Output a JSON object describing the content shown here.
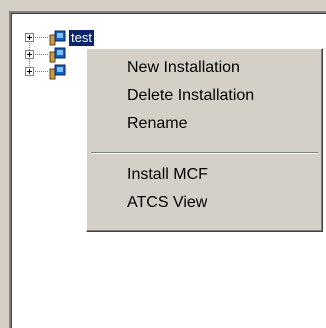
{
  "tree": {
    "items": [
      {
        "label": "test",
        "selected": true
      },
      {
        "label": ""
      },
      {
        "label": ""
      }
    ]
  },
  "context_menu": {
    "items": [
      {
        "label": "New Installation"
      },
      {
        "label": "Delete Installation"
      },
      {
        "label": "Rename"
      },
      {
        "label": "Install MCF"
      },
      {
        "label": "ATCS View"
      }
    ]
  },
  "colors": {
    "window_bg": "#d4d0c8",
    "selection_bg": "#0a246a",
    "selection_text": "#ffffff"
  }
}
